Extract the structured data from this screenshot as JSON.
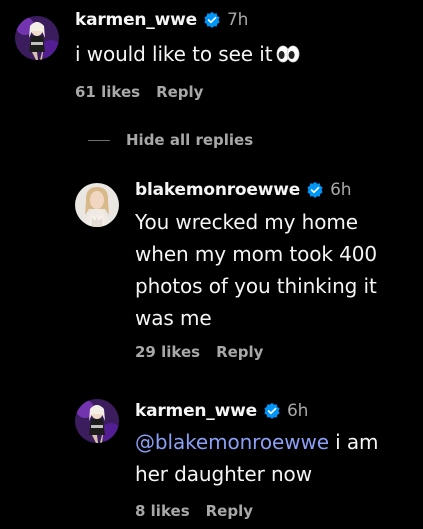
{
  "comments": [
    {
      "username": "karmen_wwe",
      "verified": true,
      "time": "7h",
      "text": "i would like to see it",
      "emoji": "eyes-emoji",
      "likes": "61 likes",
      "reply_label": "Reply"
    }
  ],
  "replies_toggle": {
    "label": "Hide all replies"
  },
  "replies": [
    {
      "username": "blakemonroewwe",
      "verified": true,
      "time": "6h",
      "text_lines": [
        "You wrecked my home",
        "when my mom took 400",
        "photos of you thinking it",
        "was me"
      ],
      "likes": "29 likes",
      "reply_label": "Reply"
    },
    {
      "username": "karmen_wwe",
      "verified": true,
      "time": "6h",
      "mention": "@blakemonroewwe",
      "text_line1_rest": " i am",
      "text_line2": "her daughter now",
      "likes": "8 likes",
      "reply_label": "Reply"
    }
  ],
  "colors": {
    "background": "#000000",
    "text": "#f5f5f5",
    "secondary": "#a8a8a8",
    "verified_badge": "#0095f6",
    "mention": "#8b9ff5"
  }
}
